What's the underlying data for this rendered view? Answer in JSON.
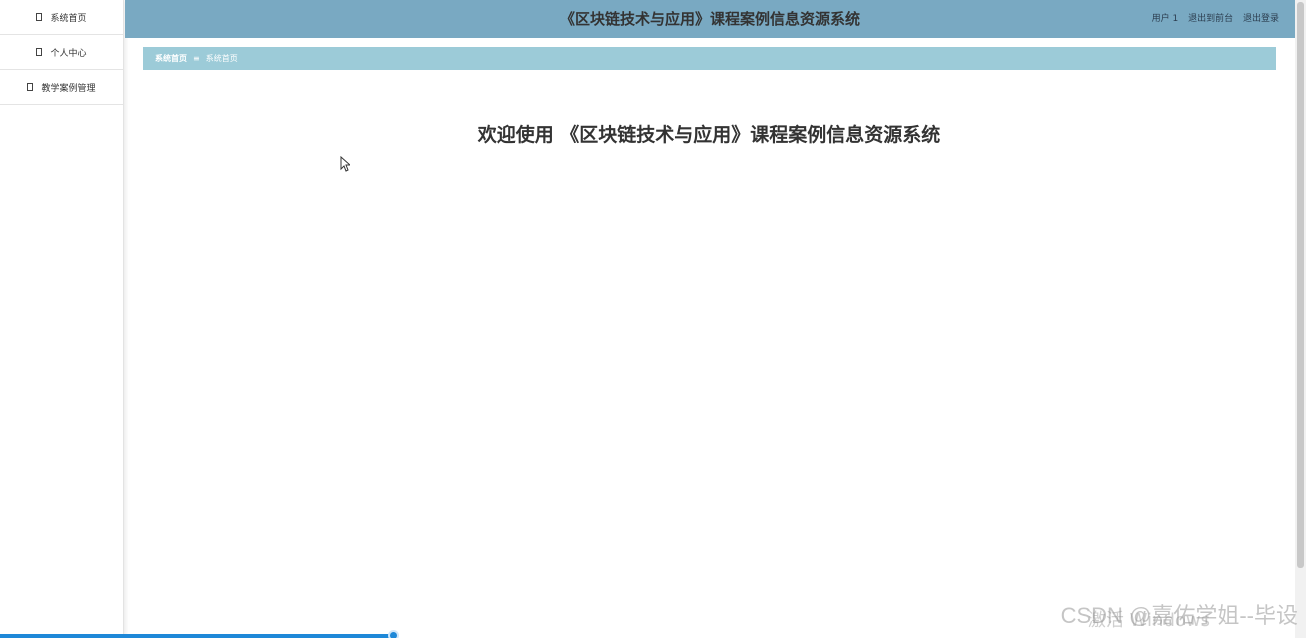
{
  "sidebar": {
    "items": [
      {
        "label": "系统首页",
        "icon": "page-icon"
      },
      {
        "label": "个人中心",
        "icon": "page-icon"
      },
      {
        "label": "教学案例管理",
        "icon": "page-icon"
      }
    ]
  },
  "header": {
    "title": "《区块链技术与应用》课程案例信息资源系统",
    "user": "用户 1",
    "front_link": "退出到前台",
    "logout_link": "退出登录",
    "bg_color": "#79a9c2"
  },
  "breadcrumb": {
    "root": "系统首页",
    "separator": "≡",
    "current": "系统首页"
  },
  "main": {
    "welcome": "欢迎使用 《区块链技术与应用》课程案例信息资源系统"
  },
  "overlay": {
    "activate_windows": "激活 Windows",
    "csdn_watermark": "CSDN @嘉佑学姐--毕设"
  }
}
